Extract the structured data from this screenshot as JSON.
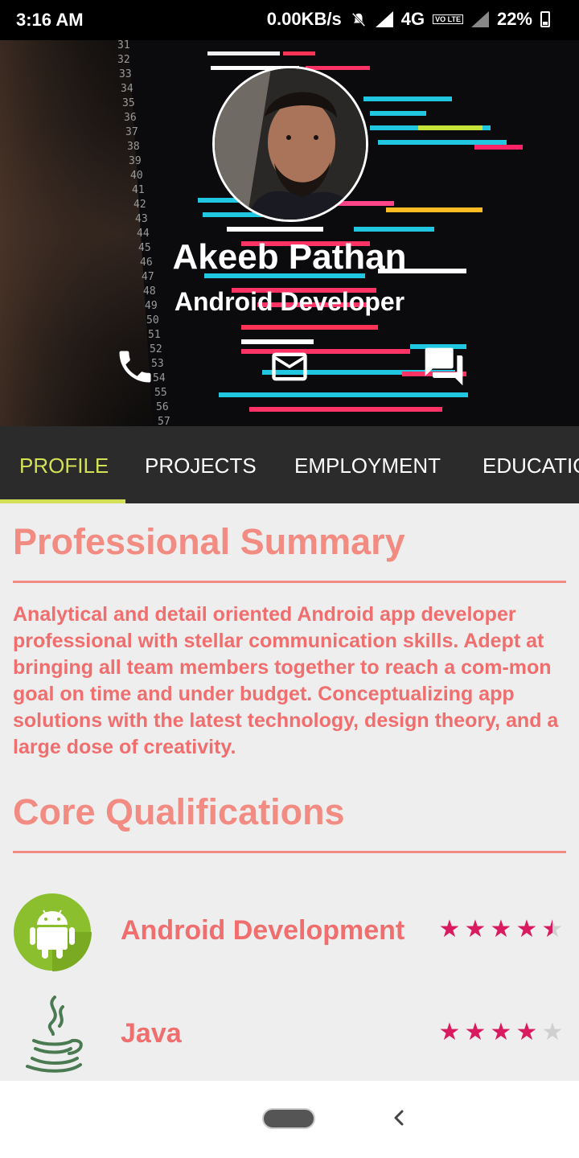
{
  "status_bar": {
    "time": "3:16 AM",
    "network_speed": "0.00KB/s",
    "network_type": "4G",
    "volte": "VO LTE",
    "battery": "22%"
  },
  "profile": {
    "name": "Akeeb Pathan",
    "title": "Android Developer",
    "actions": [
      "phone-icon",
      "email-icon",
      "chat-icon"
    ]
  },
  "tabs": [
    {
      "label": "PROFILE",
      "active": true
    },
    {
      "label": "PROJECTS",
      "active": false
    },
    {
      "label": "EMPLOYMENT",
      "active": false
    },
    {
      "label": "EDUCATIO",
      "active": false
    }
  ],
  "summary": {
    "heading": "Professional Summary",
    "text": "Analytical and detail oriented Android app developer professional with stellar communication skills. Adept at bringing all team members together to reach a com-mon goal on time and under budget. Conceptualizing app solutions with the latest technology, design theory, and a large dose of creativity."
  },
  "qualifications": {
    "heading": "Core Qualifications",
    "items": [
      {
        "name": "Android Development",
        "icon": "android-icon",
        "rating": 4.5,
        "max": 5
      },
      {
        "name": "Java",
        "icon": "java-icon",
        "rating": 4,
        "max": 5
      }
    ]
  },
  "colors": {
    "accent": "#d4e157",
    "heading": "#f28b82",
    "star": "#d81b60",
    "tab_bar": "#2b2b2b"
  }
}
